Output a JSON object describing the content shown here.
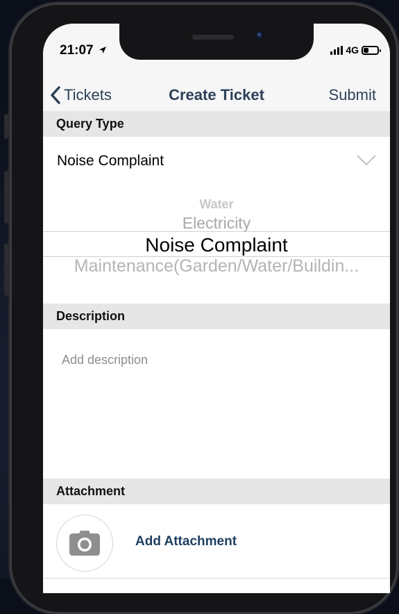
{
  "status_bar": {
    "time": "21:07",
    "network": "4G",
    "battery_level": 0.35
  },
  "nav": {
    "back_label": "Tickets",
    "title": "Create Ticket",
    "action_label": "Submit"
  },
  "query_type": {
    "header": "Query Type",
    "selected_value": "Noise Complaint",
    "options": [
      "Water",
      "Electricity",
      "Noise Complaint",
      "Maintenance(Garden/Water/Buildin..."
    ]
  },
  "description": {
    "header": "Description",
    "placeholder": "Add description"
  },
  "attachment": {
    "header": "Attachment",
    "add_label": "Add Attachment"
  },
  "colors": {
    "accent": "#2c4158",
    "link": "#1f3f62",
    "section_bg": "#e6e6e7"
  }
}
